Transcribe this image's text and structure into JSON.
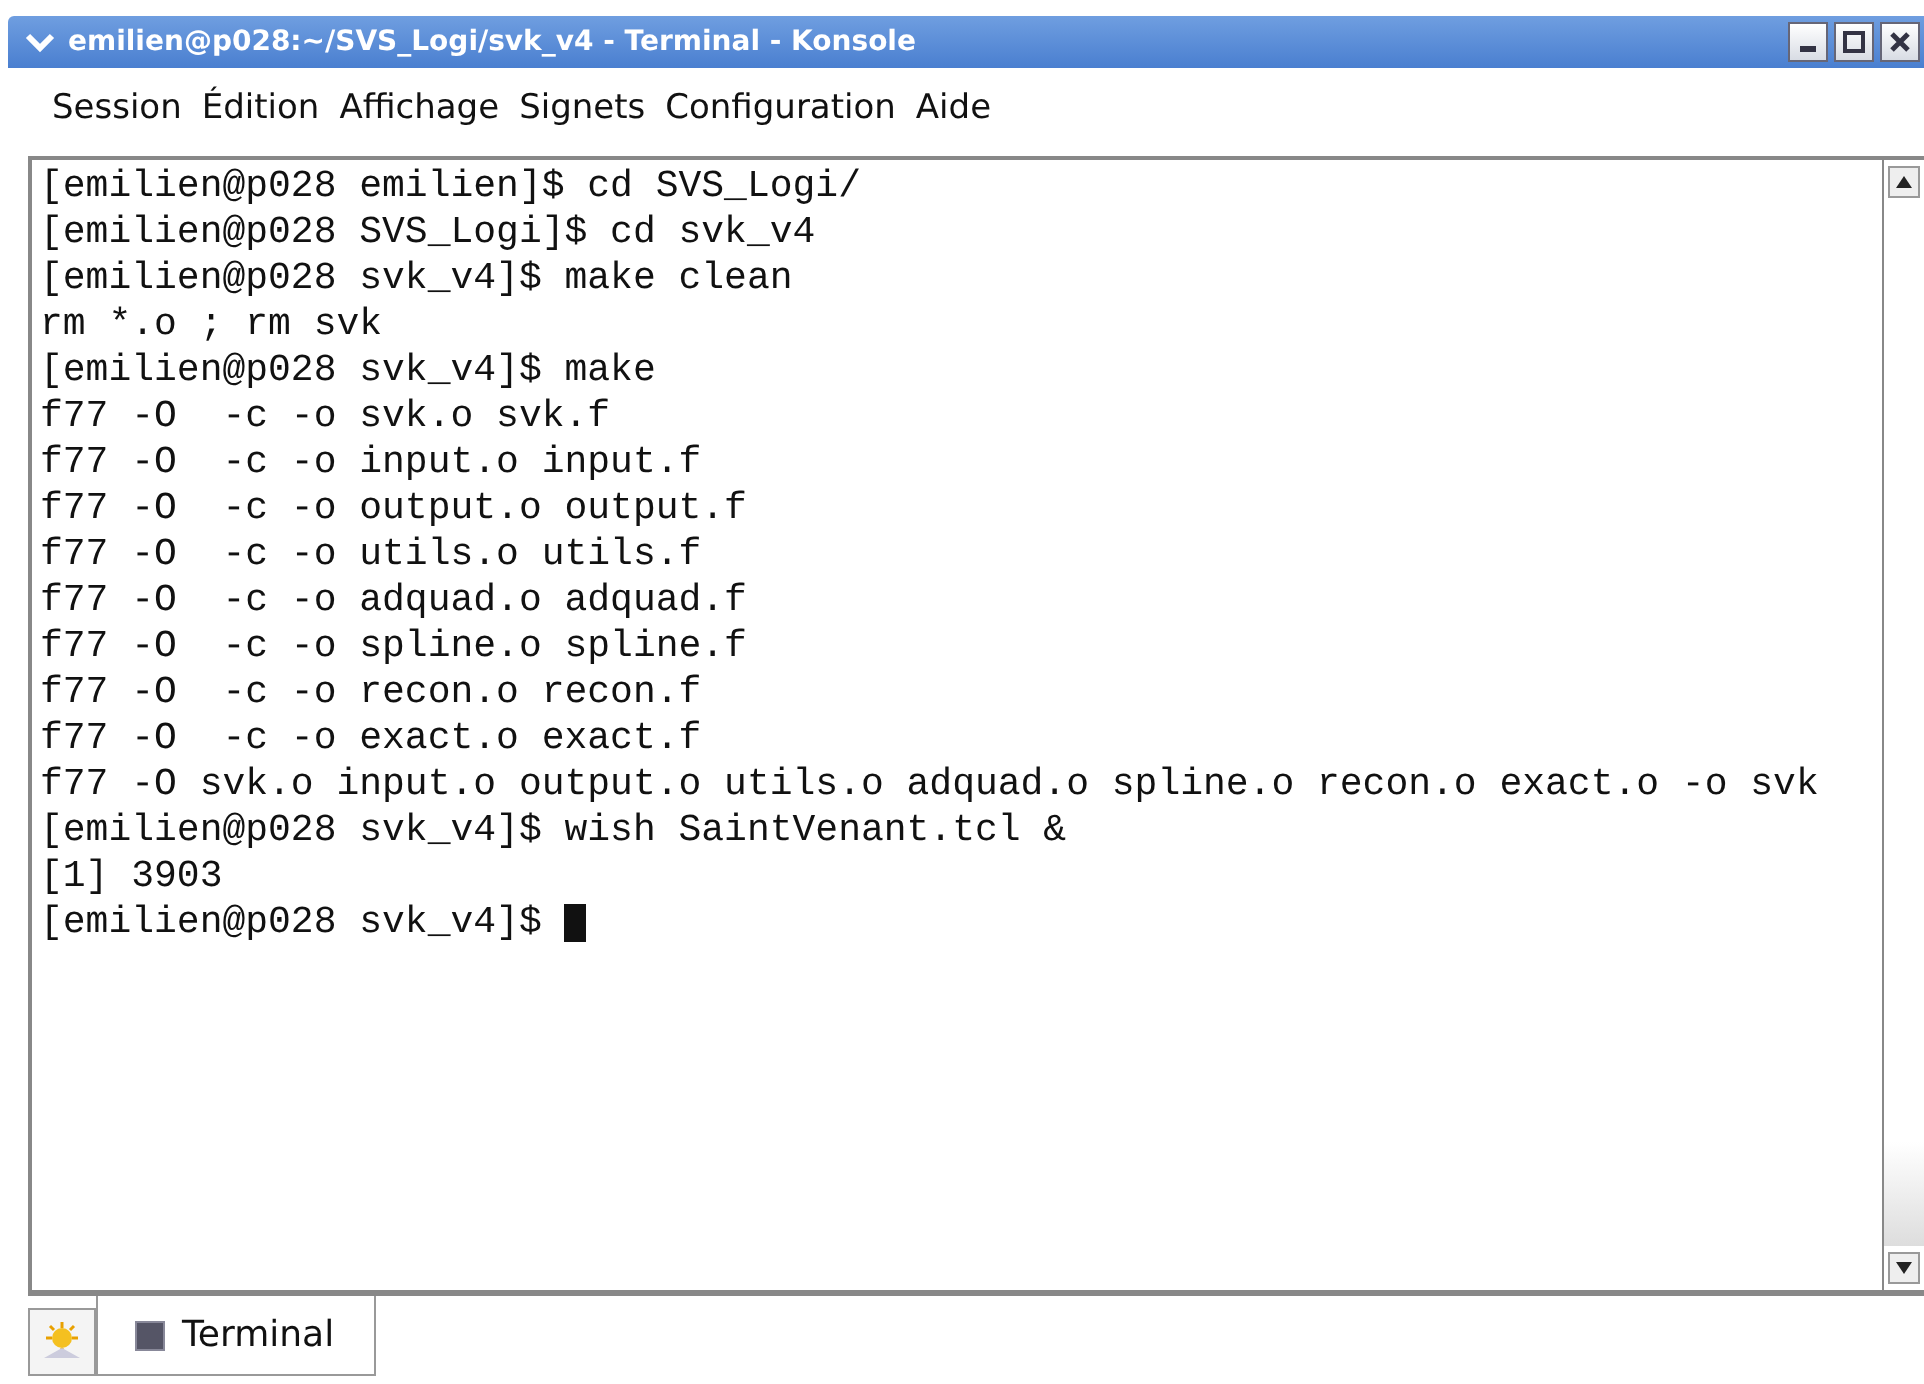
{
  "window": {
    "title": "emilien@p028:~/SVS_Logi/svk_v4 - Terminal - Konsole"
  },
  "menu": [
    "Session",
    "Édition",
    "Affichage",
    "Signets",
    "Configuration",
    "Aide"
  ],
  "terminal": {
    "lines": [
      "[emilien@p028 emilien]$ cd SVS_Logi/",
      "[emilien@p028 SVS_Logi]$ cd svk_v4",
      "[emilien@p028 svk_v4]$ make clean",
      "rm *.o ; rm svk",
      "[emilien@p028 svk_v4]$ make",
      "f77 -O  -c -o svk.o svk.f",
      "f77 -O  -c -o input.o input.f",
      "f77 -O  -c -o output.o output.f",
      "f77 -O  -c -o utils.o utils.f",
      "f77 -O  -c -o adquad.o adquad.f",
      "f77 -O  -c -o spline.o spline.f",
      "f77 -O  -c -o recon.o recon.f",
      "f77 -O  -c -o exact.o exact.f",
      "f77 -O svk.o input.o output.o utils.o adquad.o spline.o recon.o exact.o -o svk",
      "[emilien@p028 svk_v4]$ wish SaintVenant.tcl &",
      "[1] 3903"
    ],
    "prompt": "[emilien@p028 svk_v4]$ "
  },
  "tabs": [
    {
      "label": "Terminal",
      "selected": true
    }
  ]
}
